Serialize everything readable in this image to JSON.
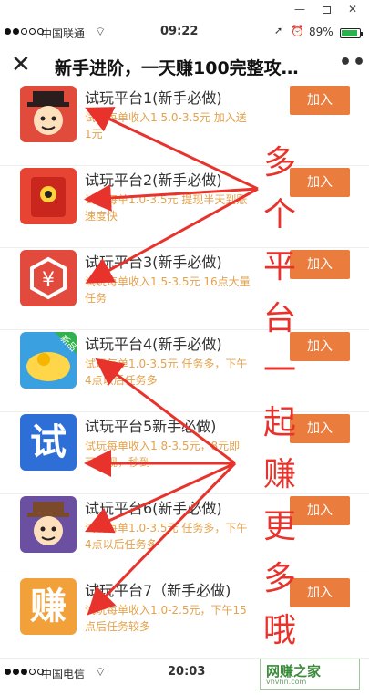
{
  "window": {
    "minimize": "—",
    "close": "✕"
  },
  "status_top": {
    "carrier": "中国联通",
    "time": "09:22",
    "battery": "89%",
    "battery_level": 0.89
  },
  "nav": {
    "title": "新手进阶，一天赚100完整攻…",
    "close_icon": "close-icon",
    "more": "•••"
  },
  "items": [
    {
      "title": "试玩平台1(新手必做)",
      "desc": "试玩每单收入1.5.0-3.5元 加入送1元",
      "button": "加入",
      "icon": "hat-man-icon",
      "icon_color": "#e04b3c"
    },
    {
      "title": "试玩平台2(新手必做)",
      "desc": "试玩每单1.0-3.5元 提现半天到账速度快",
      "button": "加入",
      "icon": "red-envelope-icon",
      "icon_color": "#e84434"
    },
    {
      "title": "试玩平台3(新手必做)",
      "desc": "试玩每单收入1.5-3.5元 16点大量任务",
      "button": "加入",
      "icon": "yuan-hexagon-icon",
      "icon_color": "#e24a3e"
    },
    {
      "title": "试玩平台4(新手必做)",
      "desc": "试玩每单1.0-3.5元 任务多，下午4点以后任务多",
      "button": "加入",
      "icon": "coin-bird-icon",
      "icon_color": "#3aa0e0"
    },
    {
      "title": "试玩平台5新手必做)",
      "desc": "试玩每单收入1.8-3.5元，8元即可提现，秒到",
      "button": "加入",
      "icon": "shi-char-icon",
      "icon_color": "#2d6fd6",
      "icon_text": "试"
    },
    {
      "title": "试玩平台6(新手必做)",
      "desc": "试玩每单1.0-3.5元 任务多，下午4点以后任务多",
      "button": "加入",
      "icon": "fedora-man-icon",
      "icon_color": "#6b4fa0"
    },
    {
      "title": "试玩平台7（新手必做)",
      "desc": "试玩每单收入1.0-2.5元，下午15点后任务较多",
      "button": "加入",
      "icon": "zhuan-char-icon",
      "icon_color": "#f2a13a",
      "icon_text": "赚"
    }
  ],
  "badge_new": "新品",
  "overlay_text": [
    "多",
    "个",
    "平",
    "台",
    "一",
    "起",
    "赚",
    "更",
    "多",
    "哦"
  ],
  "status_bottom": {
    "carrier": "中国电信",
    "time": "20:03"
  },
  "watermark": {
    "text": "网赚之家",
    "sub": "vhvhn.com"
  }
}
